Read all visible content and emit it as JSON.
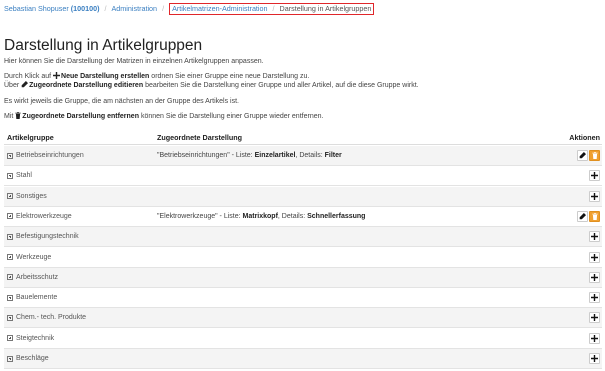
{
  "breadcrumb": {
    "user": "Sebastian Shopuser",
    "user_id": "(100100)",
    "admin": "Administration",
    "matrix_admin": "Artikelmatrizen-Administration",
    "current": "Darstellung in Artikelgruppen"
  },
  "page": {
    "title": "Darstellung in Artikelgruppen",
    "intro": "Hier können Sie die Darstellung der Matrizen in einzelnen Artikelgruppen anpassen.",
    "line2_pre": "Durch Klick auf",
    "line2_bold": "Neue Darstellung erstellen",
    "line2_post": "ordnen Sie einer Gruppe eine neue Darstellung zu.",
    "line3_pre": "Über",
    "line3_bold": "Zugeordnete Darstellung editieren",
    "line3_post": "bearbeiten Sie die Darstellung einer Gruppe und aller Artikel, auf die diese Gruppe wirkt.",
    "line4": "Es wirkt jeweils die Gruppe, die am nächsten an der Gruppe des Artikels ist.",
    "line5_pre": "Mit",
    "line5_bold": "Zugeordnete Darstellung entfernen",
    "line5_post": "können Sie die Darstellung einer Gruppe wieder entfernen."
  },
  "table": {
    "headers": {
      "group": "Artikelgruppe",
      "assigned": "Zugeordnete Darstellung",
      "actions": "Aktionen"
    },
    "rows": [
      {
        "name": "Betriebseinrichtungen",
        "has_assign": true,
        "a_quote": "\"Betriebseinrichtungen\" - Liste: ",
        "a_list": "Einzelartikel",
        "a_mid": ", Details: ",
        "a_details": "Filter"
      },
      {
        "name": "Stahl",
        "has_assign": false
      },
      {
        "name": "Sonstiges",
        "has_assign": false
      },
      {
        "name": "Elektrowerkzeuge",
        "has_assign": true,
        "a_quote": "\"Elektrowerkzeuge\" - Liste: ",
        "a_list": "Matrixkopf",
        "a_mid": ", Details: ",
        "a_details": "Schnellerfassung"
      },
      {
        "name": "Befestigungstechnik",
        "has_assign": false
      },
      {
        "name": "Werkzeuge",
        "has_assign": false
      },
      {
        "name": "Arbeitsschutz",
        "has_assign": false
      },
      {
        "name": "Bauelemente",
        "has_assign": false
      },
      {
        "name": "Chem.- tech. Produkte",
        "has_assign": false
      },
      {
        "name": "Steigtechnik",
        "has_assign": false
      },
      {
        "name": "Beschläge",
        "has_assign": false
      }
    ]
  },
  "icons": {
    "plus": "plus-icon",
    "pencil": "pencil-icon",
    "trash": "trash-icon"
  },
  "colors": {
    "link": "#3a7fc1",
    "highlight_border": "#e0262a",
    "delete_button": "#f0a030"
  }
}
